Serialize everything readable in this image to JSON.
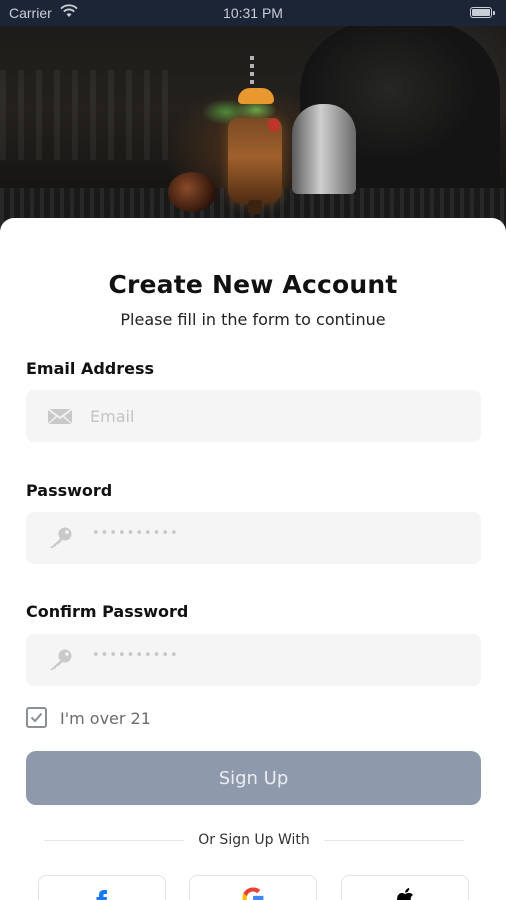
{
  "status_bar": {
    "carrier": "Carrier",
    "time": "10:31 PM"
  },
  "hero": {
    "icon": "cocktail-photo"
  },
  "form": {
    "title": "Create New Account",
    "subtitle": "Please fill in the form to continue",
    "email": {
      "label": "Email Address",
      "placeholder": "Email",
      "value": "",
      "icon": "envelope-icon"
    },
    "password": {
      "label": "Password",
      "masked_value": "••••••••••",
      "icon": "key-icon"
    },
    "confirm_password": {
      "label": "Confirm Password",
      "masked_value": "••••••••••",
      "icon": "key-icon"
    },
    "age_check": {
      "label": "I'm over 21",
      "checked": true
    },
    "submit_label": "Sign Up"
  },
  "social": {
    "divider_text": "Or Sign Up With",
    "providers": [
      "facebook",
      "google",
      "apple"
    ]
  },
  "colors": {
    "status_bar_bg": "#1c2536",
    "field_bg": "#f5f5f5",
    "button_bg": "#8e9aab",
    "facebook_blue": "#1877f2"
  }
}
